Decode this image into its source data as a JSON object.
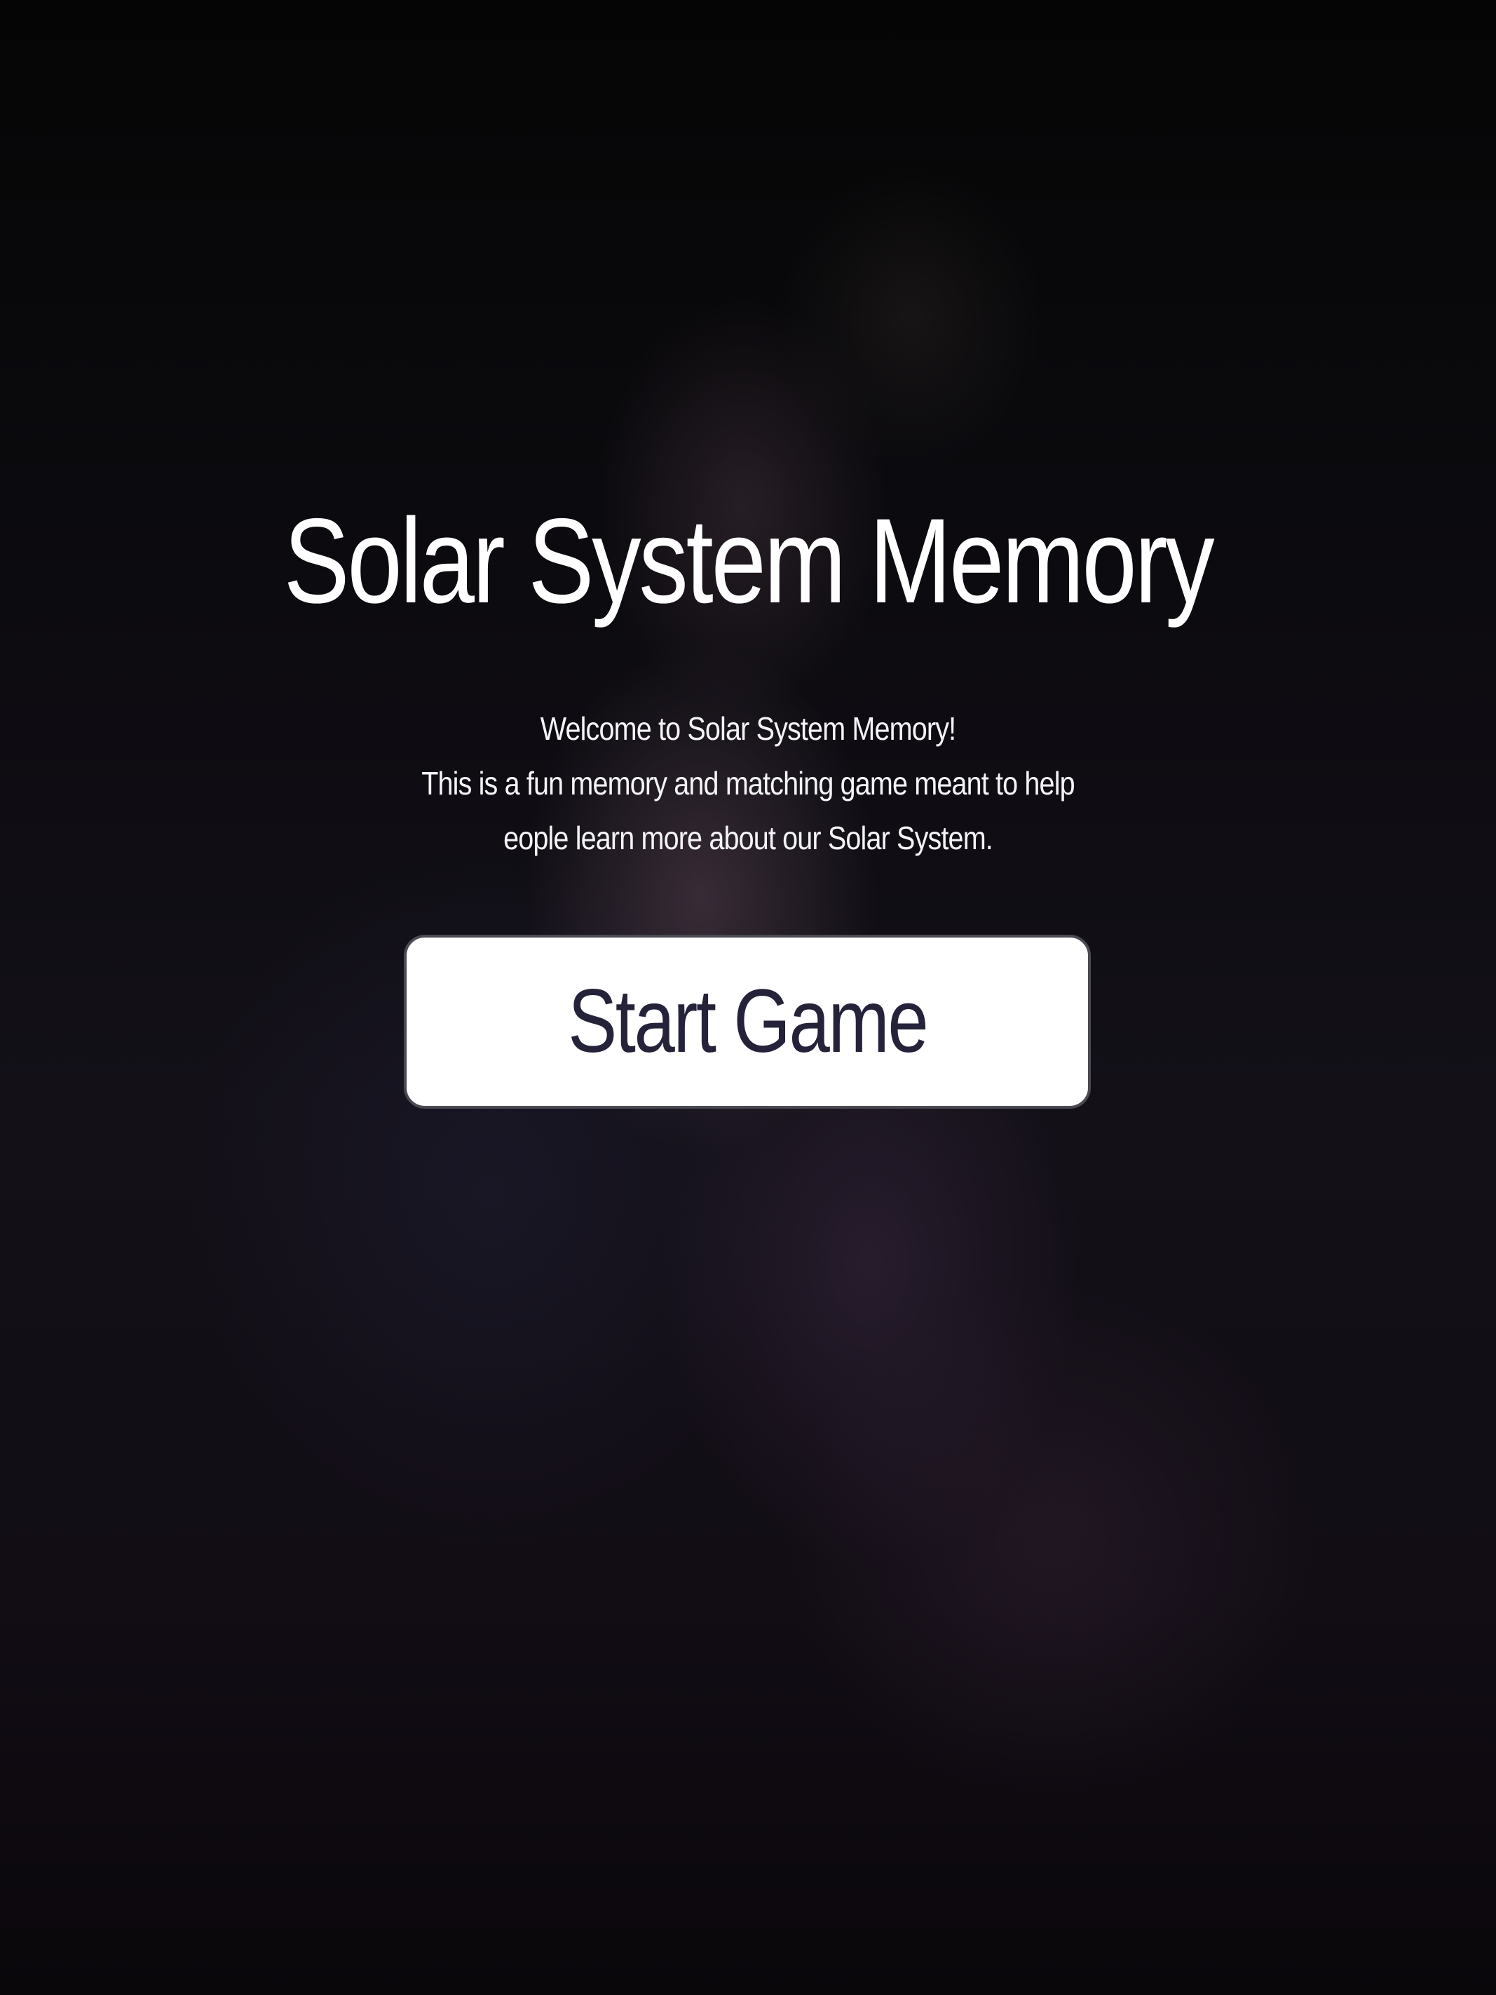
{
  "page": {
    "title": "Solar System Memory",
    "intro_lines": [
      "Welcome to Solar System Memory!",
      "This is a fun memory and matching game meant to help",
      "eople learn more about our Solar System."
    ],
    "start_button_label": "Start Game"
  },
  "colors": {
    "text": "#ffffff",
    "button_background": "#ffffff",
    "button_text": "#25233a",
    "button_border": "#4a4a52",
    "sky_background": "#050505"
  }
}
